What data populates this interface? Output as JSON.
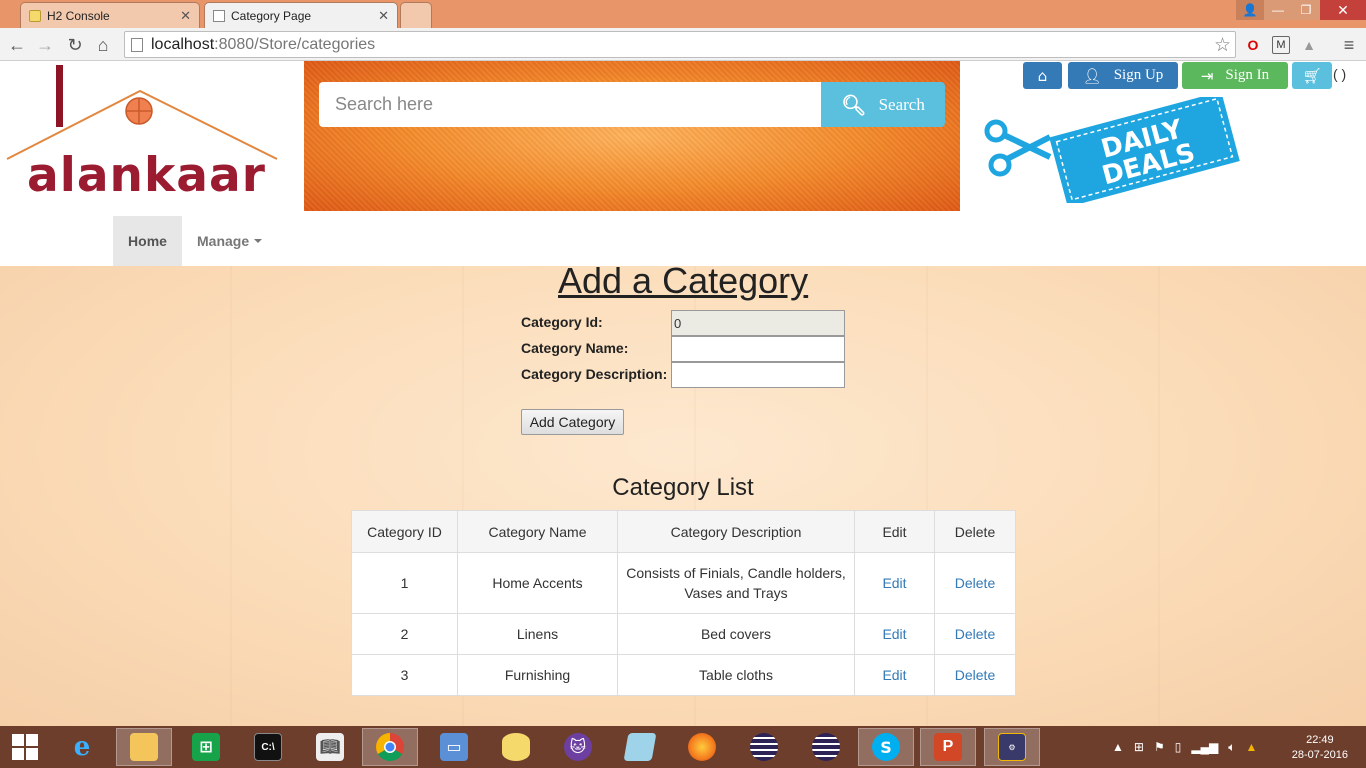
{
  "browser": {
    "tabs": [
      {
        "title": "H2 Console",
        "active": false
      },
      {
        "title": "Category Page",
        "active": true
      }
    ],
    "url_host": "localhost",
    "url_rest": ":8080/Store/categories"
  },
  "header": {
    "search_placeholder": "Search here",
    "search_label": "Search",
    "signup_label": "Sign Up",
    "signin_label": "Sign In",
    "cart_count": "( )",
    "logo_text": "alankaar",
    "deals_text": [
      "DAILY",
      "DEALS"
    ]
  },
  "nav": {
    "home": "Home",
    "manage": "Manage"
  },
  "form": {
    "title": "Add a Category",
    "id_label": "Category Id:",
    "id_value": "0",
    "name_label": "Category Name:",
    "name_value": "",
    "desc_label": "Category Description:",
    "desc_value": "",
    "submit_label": "Add Category"
  },
  "list": {
    "title": "Category List",
    "columns": [
      "Category ID",
      "Category Name",
      "Category Description",
      "Edit",
      "Delete"
    ],
    "rows": [
      {
        "id": "1",
        "name": "Home Accents",
        "desc": "Consists of Finials, Candle holders, Vases and Trays",
        "edit": "Edit",
        "delete": "Delete"
      },
      {
        "id": "2",
        "name": "Linens",
        "desc": "Bed covers",
        "edit": "Edit",
        "delete": "Delete"
      },
      {
        "id": "3",
        "name": "Furnishing",
        "desc": "Table cloths",
        "edit": "Edit",
        "delete": "Delete"
      }
    ]
  },
  "taskbar": {
    "time": "22:49",
    "date": "28-07-2016"
  },
  "colors": {
    "primary": "#337ab7",
    "success": "#5cb85c",
    "info": "#5bc0de",
    "brand": "#9b1b30"
  }
}
